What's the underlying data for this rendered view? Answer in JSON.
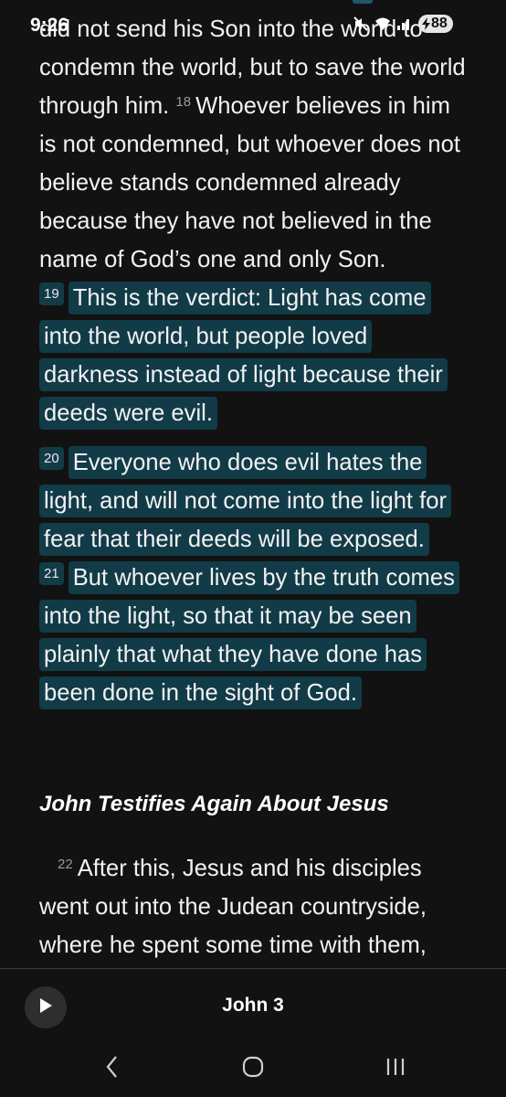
{
  "status_bar": {
    "time": "9:26",
    "battery_level": "88"
  },
  "reader": {
    "paragraphs": [
      {
        "segments": [
          {
            "type": "text",
            "text": "did not send his Son into the world to condemn the world, but to save the world through him. "
          },
          {
            "type": "verse",
            "text": "18"
          },
          {
            "type": "text",
            "text": "Whoever believes in him is not condemned, but whoever does not believe stands condemned already because they have not believed in the name of God’s one and only Son. "
          },
          {
            "type": "verse",
            "text": "19",
            "highlight": true
          },
          {
            "type": "text",
            "text": "This is the verdict: Light has come into the world, but people loved darkness instead of light because their deeds were evil.",
            "highlight": true
          }
        ]
      },
      {
        "segments": [
          {
            "type": "verse",
            "text": "20",
            "highlight": true
          },
          {
            "type": "text",
            "text": "Everyone who does evil hates the light, and will not come into the light for fear that their deeds will be exposed. ",
            "highlight": true
          },
          {
            "type": "verse",
            "text": "21",
            "highlight": true
          },
          {
            "type": "text",
            "text": "But whoever lives by the truth comes into the light, so that it may be seen plainly that what they have done has been done in the sight of God.",
            "highlight": true
          }
        ]
      },
      {
        "segments": [
          {
            "type": "verse",
            "text": "22"
          },
          {
            "type": "text",
            "text": "After this, Jesus and his disciples went out into the Judean countryside, where he spent some time with them,"
          }
        ]
      }
    ],
    "section_heading": "John Testifies Again About Jesus"
  },
  "player": {
    "chapter": "John 3",
    "play_icon": "play-icon"
  },
  "nav": {
    "back_icon": "back-chevron-icon",
    "home_icon": "home-icon",
    "recents_icon": "recents-icon"
  },
  "colors": {
    "background": "#121212",
    "highlight": "#123b48",
    "text": "#f2f2f2",
    "verse_number": "#9a9a9a"
  }
}
